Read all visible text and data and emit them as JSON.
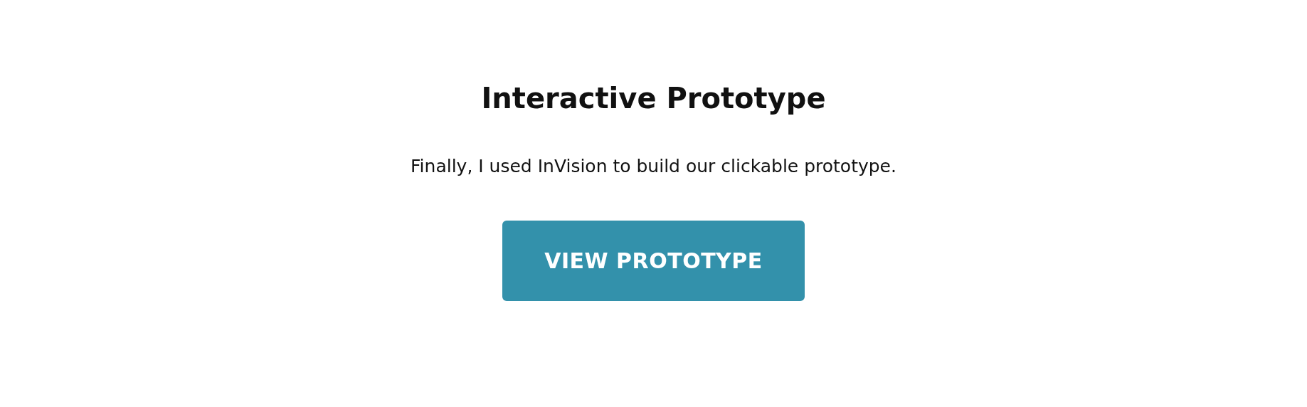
{
  "heading": "Interactive Prototype",
  "description": "Finally, I used InVision to build our clickable prototype.",
  "button": {
    "label": "VIEW PROTOTYPE"
  }
}
